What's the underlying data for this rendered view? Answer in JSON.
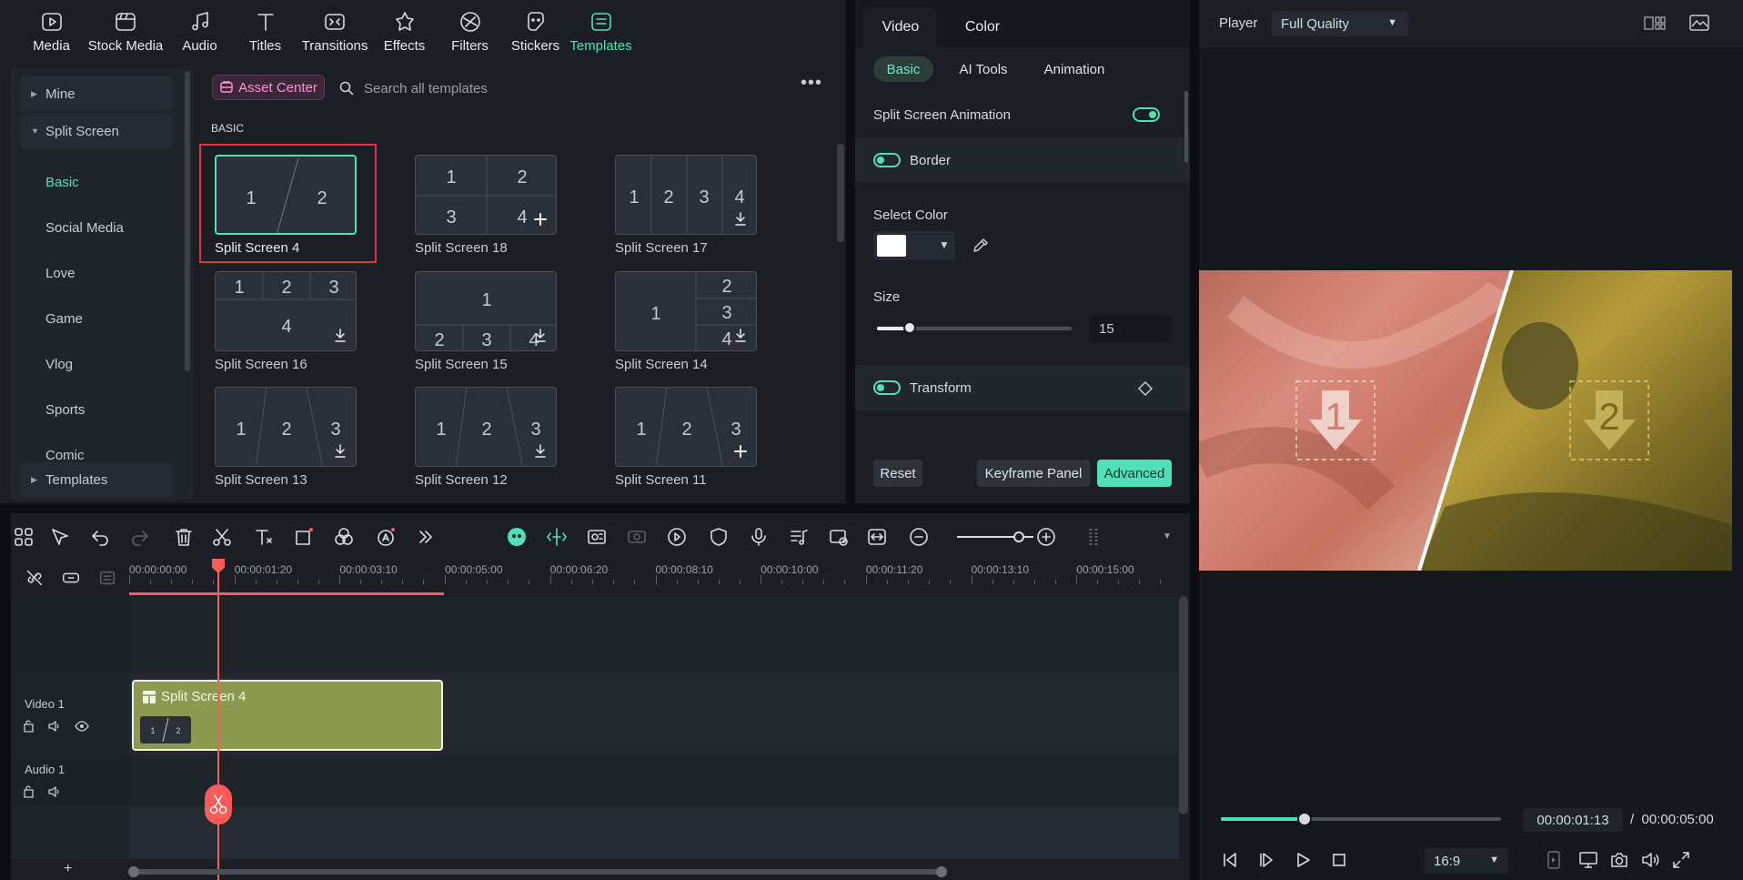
{
  "toolbar": {
    "tabs": [
      {
        "label": "Media",
        "icon": "media-icon"
      },
      {
        "label": "Stock Media",
        "icon": "stock-media-icon"
      },
      {
        "label": "Audio",
        "icon": "audio-icon"
      },
      {
        "label": "Titles",
        "icon": "titles-icon"
      },
      {
        "label": "Transitions",
        "icon": "transitions-icon"
      },
      {
        "label": "Effects",
        "icon": "effects-icon"
      },
      {
        "label": "Filters",
        "icon": "filters-icon"
      },
      {
        "label": "Stickers",
        "icon": "stickers-icon"
      },
      {
        "label": "Templates",
        "icon": "templates-icon"
      }
    ],
    "active": "Templates"
  },
  "sidebar": {
    "mine": "Mine",
    "split_screen": "Split Screen",
    "subitems": [
      "Basic",
      "Social Media",
      "Love",
      "Game",
      "Vlog",
      "Sports",
      "Comic"
    ],
    "active": "Basic",
    "templates": "Templates"
  },
  "library": {
    "asset_center": "Asset Center",
    "search_placeholder": "Search all templates",
    "section": "BASIC",
    "tiles": [
      {
        "name": "Split Screen 4",
        "layout": "diag-2",
        "badge": "",
        "numbers": [
          "1",
          "2"
        ]
      },
      {
        "name": "Split Screen 18",
        "layout": "grid-2x2",
        "badge": "add",
        "numbers": [
          "1",
          "2",
          "3",
          "4"
        ]
      },
      {
        "name": "Split Screen 17",
        "layout": "cols-4",
        "badge": "download",
        "numbers": [
          "1",
          "2",
          "3",
          "4"
        ]
      },
      {
        "name": "Split Screen 16",
        "layout": "top3-bottom1",
        "badge": "download",
        "numbers": [
          "1",
          "2",
          "3",
          "4"
        ]
      },
      {
        "name": "Split Screen 15",
        "layout": "top1-bottom3",
        "badge": "download",
        "numbers": [
          "1",
          "2",
          "3",
          "4"
        ]
      },
      {
        "name": "Split Screen 14",
        "layout": "left1-right3",
        "badge": "download",
        "numbers": [
          "1",
          "2",
          "3",
          "4"
        ]
      },
      {
        "name": "Split Screen 13",
        "layout": "diag-3",
        "badge": "download",
        "numbers": [
          "1",
          "2",
          "3"
        ]
      },
      {
        "name": "Split Screen 12",
        "layout": "diag-3",
        "badge": "download",
        "numbers": [
          "1",
          "2",
          "3"
        ]
      },
      {
        "name": "Split Screen 11",
        "layout": "diag-3",
        "badge": "add",
        "numbers": [
          "1",
          "2",
          "3"
        ]
      }
    ],
    "selected": "Split Screen 4"
  },
  "properties": {
    "tabs": [
      "Video",
      "Color"
    ],
    "active_tab": "Video",
    "subtabs": [
      "Basic",
      "AI Tools",
      "Animation"
    ],
    "active_subtab": "Basic",
    "split_anim_label": "Split Screen Animation",
    "split_anim_on": true,
    "border_label": "Border",
    "border_on": true,
    "select_color_label": "Select Color",
    "color": "#ffffff",
    "size_label": "Size",
    "size_value": "15",
    "size_fraction": 0.17,
    "transform_label": "Transform",
    "transform_on": true,
    "reset": "Reset",
    "keyframe": "Keyframe Panel",
    "advanced": "Advanced"
  },
  "player": {
    "label": "Player",
    "quality": "Full Quality",
    "current_time": "00:00:01:13",
    "separator": "/",
    "total_time": "00:00:05:00",
    "progress_fraction": 0.3,
    "ratio": "16:9",
    "slot_numbers": [
      "1",
      "2"
    ]
  },
  "timeline": {
    "ruler": [
      "00:00:00:00",
      "00:00:01:20",
      "00:00:03:10",
      "00:00:05:00",
      "00:00:06:20",
      "00:00:08:10",
      "00:00:10:00",
      "00:00:11:20",
      "00:00:13:10",
      "00:00:15:00"
    ],
    "tracks": [
      {
        "name": "Video 1"
      },
      {
        "name": "Audio 1"
      }
    ],
    "clip": {
      "name": "Split Screen 4",
      "numbers": [
        "1",
        "2"
      ]
    },
    "add": "+"
  },
  "colors": {
    "accent": "#4fe0b6",
    "playhead": "#ff5a5a",
    "clip": "#8a9a4f",
    "highlight_frame": "#e8303a",
    "asset_center": "#ff8fd8"
  }
}
